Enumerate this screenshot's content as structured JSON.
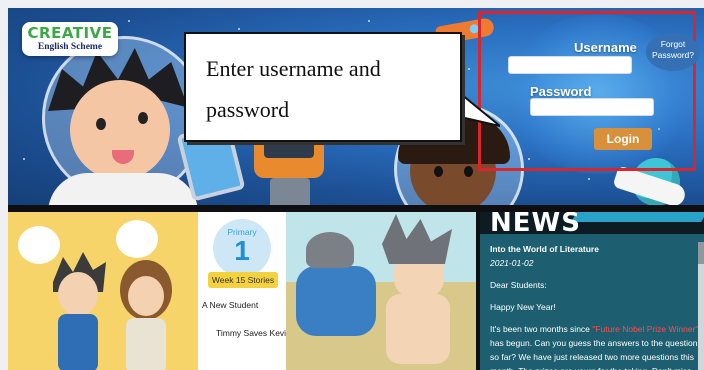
{
  "logo": {
    "word": "CREATIVE",
    "subtitle": "English Scheme"
  },
  "callout": {
    "line1": "Enter username and",
    "line2": "password"
  },
  "login": {
    "username_label": "Username",
    "username_value": "",
    "password_label": "Password",
    "password_value": "",
    "login_button": "Login",
    "forgot_line1": "Forgot",
    "forgot_line2": "Password?"
  },
  "stories": {
    "level_label": "Primary",
    "level_number": "1",
    "week_badge": "Week 15 Stories",
    "items": [
      "A New Student",
      "Timmy Saves Kevin"
    ]
  },
  "news": {
    "heading": "NEWS",
    "post_title": "Into the World of Literature",
    "post_date": "2021-01-02",
    "greeting": "Dear Students:",
    "new_year": "Happy New Year!",
    "para_before": "It's been two months since ",
    "highlight": "\"Future Nobel Prize Winner\"",
    "para_after": " has begun. Can you guess the answers to the questions so far? We have just released two more questions this month. The prizes are yours for the taking. Don't miss"
  },
  "colors": {
    "banner": "#2a6fc0",
    "highlight_box": "#d9262c",
    "login_button": "#d8913a",
    "news_bg": "#1d5f70"
  }
}
